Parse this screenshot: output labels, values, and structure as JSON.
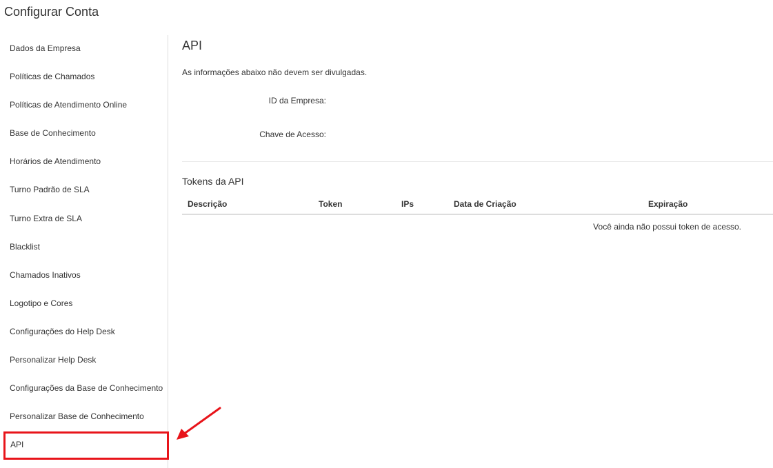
{
  "header": {
    "title": "Configurar Conta"
  },
  "sidebar": {
    "items": [
      {
        "label": "Dados da Empresa"
      },
      {
        "label": "Políticas de Chamados"
      },
      {
        "label": "Políticas de Atendimento Online"
      },
      {
        "label": "Base de Conhecimento"
      },
      {
        "label": "Horários de Atendimento"
      },
      {
        "label": "Turno Padrão de SLA"
      },
      {
        "label": "Turno Extra de SLA"
      },
      {
        "label": "Blacklist"
      },
      {
        "label": "Chamados Inativos"
      },
      {
        "label": "Logotipo e Cores"
      },
      {
        "label": "Configurações do Help Desk"
      },
      {
        "label": "Personalizar Help Desk"
      },
      {
        "label": "Configurações da Base de Conhecimento"
      },
      {
        "label": "Personalizar Base de Conhecimento"
      },
      {
        "label": "API"
      }
    ],
    "active_index": 14
  },
  "main": {
    "section_title": "API",
    "info_text": "As informações abaixo não devem ser divulgadas.",
    "fields": {
      "company_id_label": "ID da Empresa:",
      "company_id_value": "",
      "access_key_label": "Chave de Acesso:",
      "access_key_value": ""
    },
    "tokens": {
      "title": "Tokens da API",
      "columns": [
        "Descrição",
        "Token",
        "IPs",
        "Data de Criação",
        "Expiração"
      ],
      "empty_message": "Você ainda não possui token de acesso."
    }
  },
  "annotation": {
    "highlight_color": "#e8141a"
  }
}
